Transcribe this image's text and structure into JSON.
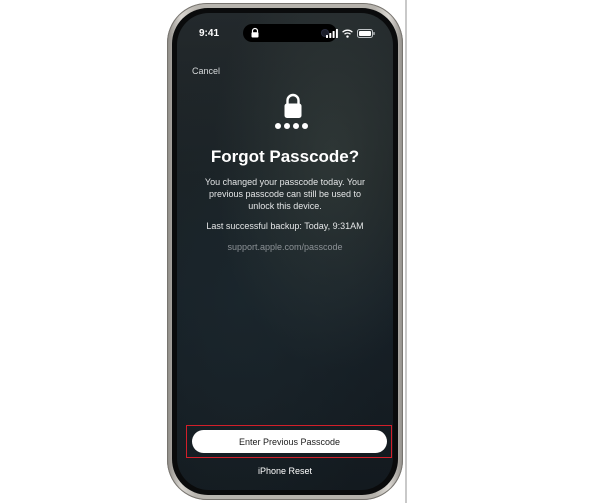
{
  "status_bar": {
    "time": "9:41",
    "icons": [
      "signal-icon",
      "wifi-icon",
      "battery-icon"
    ]
  },
  "nav": {
    "cancel_label": "Cancel"
  },
  "main": {
    "icon": "lock-icon",
    "passcode_dots": 4,
    "title": "Forgot Passcode?",
    "description": "You changed your passcode today. Your previous passcode can still be used to unlock this device.",
    "backup_text": "Last successful backup: Today,  9:31AM",
    "support_link": "support.apple.com/passcode"
  },
  "actions": {
    "primary_label": "Enter Previous Passcode",
    "secondary_label": "iPhone Reset"
  },
  "colors": {
    "highlight_border": "#d21f2a",
    "button_background": "#ffffff",
    "screen_background": "#1b2124"
  }
}
